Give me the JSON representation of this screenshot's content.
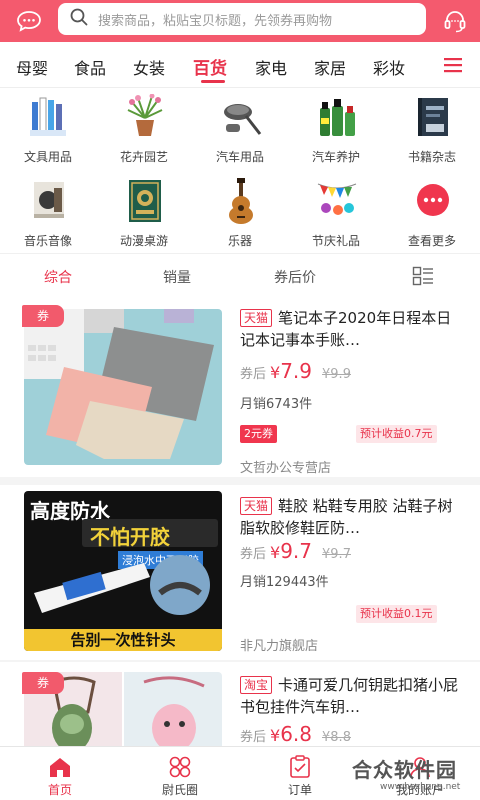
{
  "search": {
    "placeholder": "搜索商品，粘贴宝贝标题，先领券再购物"
  },
  "colors": {
    "brand": "#f45a6e",
    "accent": "#e8334b"
  },
  "header": {
    "left_icon": "chat-bubble-icon",
    "right_icon": "headset-icon"
  },
  "categories": {
    "tabs": [
      "母婴",
      "食品",
      "女装",
      "百货",
      "家电",
      "家居",
      "彩妆"
    ],
    "active": "百货",
    "menu_icon": "hamburger-menu-icon"
  },
  "grid": [
    {
      "label": "文具用品",
      "icon": "stationery-icon"
    },
    {
      "label": "花卉园艺",
      "icon": "potted-plant-icon"
    },
    {
      "label": "汽车用品",
      "icon": "car-brush-icon"
    },
    {
      "label": "汽车养护",
      "icon": "car-care-bottles-icon"
    },
    {
      "label": "书籍杂志",
      "icon": "book-icon"
    },
    {
      "label": "音乐音像",
      "icon": "cd-album-icon"
    },
    {
      "label": "动漫桌游",
      "icon": "board-game-icon"
    },
    {
      "label": "乐器",
      "icon": "guitar-icon"
    },
    {
      "label": "节庆礼品",
      "icon": "party-flags-icon"
    },
    {
      "label": "查看更多",
      "icon": "more-dots-icon"
    }
  ],
  "sort": [
    "综合",
    "销量",
    "券后价"
  ],
  "sort_active": "综合",
  "products": [
    {
      "coupon_tag": "券",
      "platform": "天猫",
      "title": "笔记本子2020年日程本日记本记事本手账…",
      "after_coupon_label": "券后",
      "currency": "¥",
      "price": "7.9",
      "original": "¥9.9",
      "sales": "月销6743件",
      "coupon_badge": "2元券",
      "earnings": "预计收益0.7元",
      "shop": "文哲办公专营店"
    },
    {
      "coupon_tag": "",
      "platform": "天猫",
      "title": "鞋胶 粘鞋专用胶 沾鞋子树脂软胶修鞋匠防…",
      "after_coupon_label": "券后",
      "currency": "¥",
      "price": "9.7",
      "original": "¥9.7",
      "sales": "月销129443件",
      "coupon_badge": "",
      "earnings": "预计收益0.1元",
      "shop": "非凡力旗舰店",
      "image_text": {
        "line1": "高度防水",
        "line2": "不怕开胶",
        "line3": "浸泡水中不开胶",
        "line4": "告别一次性针头"
      }
    },
    {
      "coupon_tag": "券",
      "platform": "淘宝",
      "title": "卡通可爱几何钥匙扣猪小屁书包挂件汽车钥…",
      "after_coupon_label": "券后",
      "currency": "¥",
      "price": "6.8",
      "original": "¥8.8"
    }
  ],
  "bottom_nav": [
    {
      "label": "首页",
      "icon": "home-icon"
    },
    {
      "label": "尉氏圈",
      "icon": "grid-circles-icon"
    },
    {
      "label": "订单",
      "icon": "order-clipboard-icon"
    },
    {
      "label": "我的账户",
      "icon": "user-icon"
    }
  ],
  "watermark": {
    "title": "合众软件园",
    "url": "www.hezhong.net"
  }
}
